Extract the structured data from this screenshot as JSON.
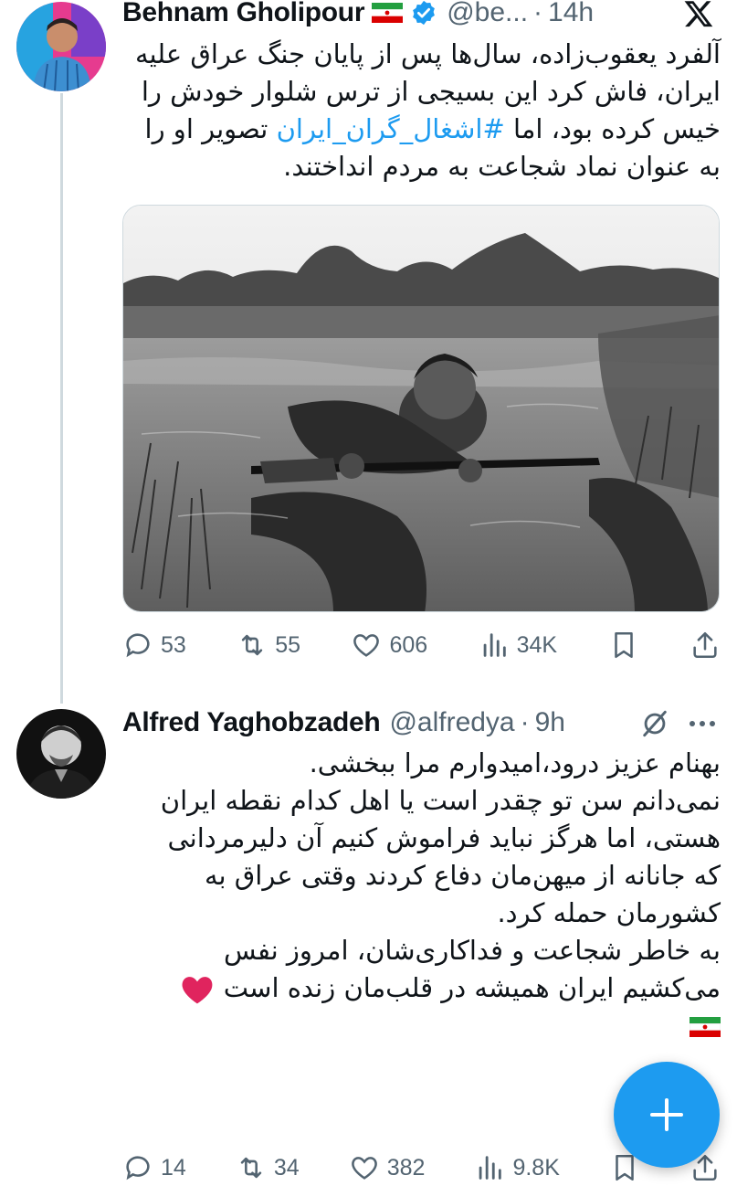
{
  "tweet1": {
    "display_name": "Behnam Gholipour",
    "handle": "@be...",
    "time": "14h",
    "text_line1": "آلفرد یعقوب‌زاده، سال‌ها پس از پایان جنگ عراق علیه",
    "text_line2": "ایران، فاش کرد این بسیجی از ترس شلوار خودش را",
    "text_line3_a": "خیس کرده بود، اما ",
    "text_line3_hashtag": "#اشغال_گران_ایران",
    "text_line3_b": " تصویر او را",
    "text_line4": "به عنوان نماد شجاعت به مردم انداختند.",
    "replies": "53",
    "reposts": "55",
    "likes": "606",
    "views": "34K"
  },
  "tweet2": {
    "display_name": "Alfred Yaghobzadeh",
    "handle": "@alfredya",
    "time": "9h",
    "lines": [
      "بهنام عزیز درود،امیدوارم مرا ببخشی.",
      "نمی‌دانم سن تو چقدر است یا اهل کدام نقطه ایران",
      "هستی، اما هرگز نباید فراموش کنیم آن دلیرمردانی",
      "که جانانه از میهن‌مان دفاع کردند وقتی عراق به",
      "کشورمان حمله کرد.",
      "به خاطر شجاعت و فداکاری‌شان، امروز نفس",
      "می‌کشیم ایران همیشه در قلب‌مان زنده است"
    ],
    "replies": "14",
    "reposts": "34",
    "likes": "382",
    "views": "9.8K"
  },
  "icons": {
    "close": "x-logo-icon",
    "verified": "verified-badge-icon",
    "flag": "iran-flag-icon",
    "heart_emoji": "red-heart-icon",
    "grok": "grok-icon",
    "more": "more-icon",
    "compose": "plus-icon"
  },
  "colors": {
    "accent": "#1d9bf0",
    "muted": "#536471",
    "text": "#0f1419",
    "heart": "#e0245e"
  }
}
